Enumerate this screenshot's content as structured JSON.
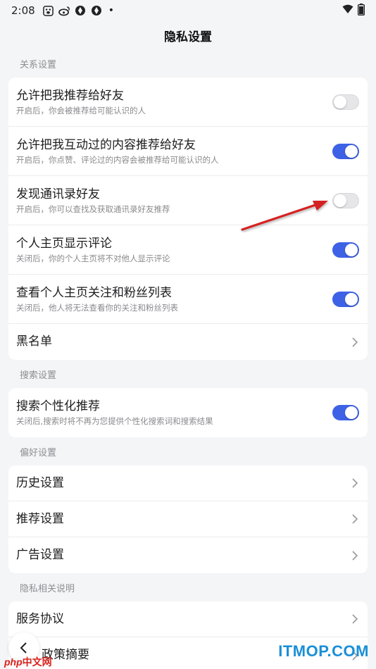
{
  "status_bar": {
    "time": "2:08",
    "icons": [
      "paw-icon",
      "weibo-icon",
      "app-icon",
      "app-icon",
      "dot-icon"
    ],
    "right_icons": [
      "wifi-icon",
      "battery-icon"
    ]
  },
  "nav": {
    "title": "隐私设置"
  },
  "sections": {
    "relationship": {
      "header": "关系设置",
      "items": [
        {
          "title": "允许把我推荐给好友",
          "subtitle": "开启后，你会被推荐给可能认识的人",
          "toggle": "off"
        },
        {
          "title": "允许把我互动过的内容推荐给好友",
          "subtitle": "开启后，你点赞、评论过的内容会被推荐给可能认识的人",
          "toggle": "on"
        },
        {
          "title": "发现通讯录好友",
          "subtitle": "开启后，你可以查找及获取通讯录好友推荐",
          "toggle": "off"
        },
        {
          "title": "个人主页显示评论",
          "subtitle": "关闭后，你的个人主页将不对他人显示评论",
          "toggle": "on"
        },
        {
          "title": "查看个人主页关注和粉丝列表",
          "subtitle": "关闭后，他人将无法查看你的关注和粉丝列表",
          "toggle": "on"
        }
      ],
      "blacklist": "黑名单"
    },
    "search": {
      "header": "搜索设置",
      "item": {
        "title": "搜索个性化推荐",
        "subtitle": "关闭后,搜索时将不再为您提供个性化搜索词和搜索结果",
        "toggle": "on"
      }
    },
    "preference": {
      "header": "偏好设置",
      "items": [
        "历史设置",
        "推荐设置",
        "广告设置"
      ]
    },
    "privacy_docs": {
      "header": "隐私相关说明",
      "items": [
        "服务协议",
        "政策摘要"
      ]
    }
  },
  "watermarks": {
    "left_brand": "php",
    "left_cn": "中文网",
    "right": "ITMOP.COM"
  },
  "colors": {
    "accent": "#3e62e6",
    "toggle_off": "#e6e6e9",
    "arrow": "#d42020",
    "background": "#f4f5f7"
  }
}
